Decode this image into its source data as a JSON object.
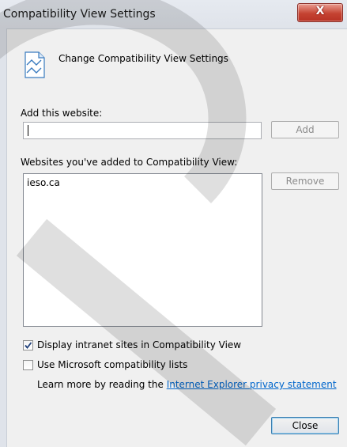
{
  "window": {
    "title": "Compatibility View Settings",
    "close_glyph": "X"
  },
  "header": {
    "icon": "compatibility-view-page-icon",
    "text": "Change Compatibility View Settings"
  },
  "add_section": {
    "label": "Add this website:",
    "input_value": "",
    "add_button": "Add"
  },
  "list_section": {
    "label": "Websites you've added to Compatibility View:",
    "items": [
      "ieso.ca"
    ],
    "remove_button": "Remove"
  },
  "options": {
    "intranet": {
      "label": "Display intranet sites in Compatibility View",
      "checked": true
    },
    "ms_lists": {
      "label": "Use Microsoft compatibility lists",
      "checked": false
    }
  },
  "learn_more": {
    "prefix": "Learn more by reading the ",
    "link_text": "Internet Explorer privacy statement"
  },
  "footer": {
    "close_button": "Close"
  },
  "colors": {
    "link": "#0066cc",
    "close_button_red": "#c54332",
    "window_bg": "#f0f0f0"
  }
}
